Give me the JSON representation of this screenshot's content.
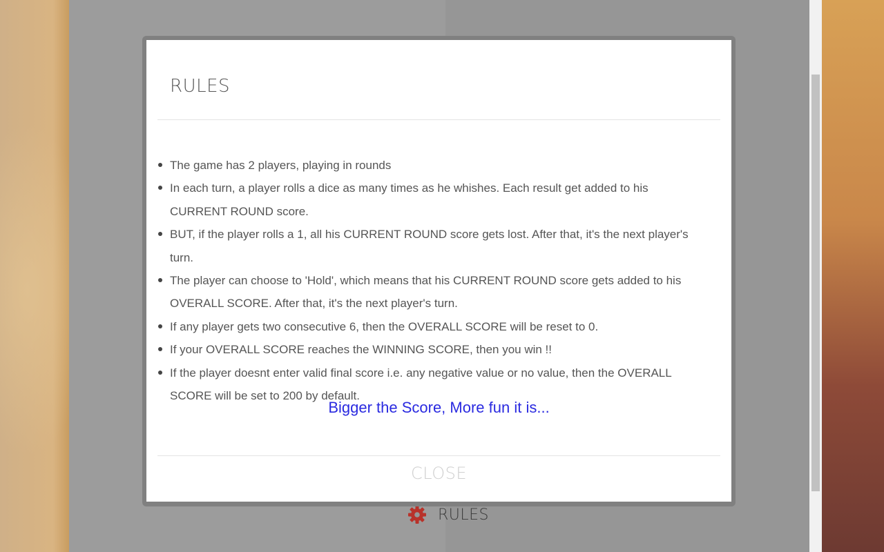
{
  "colors": {
    "accent_link": "#2a2ae0",
    "gear_icon": "#b8322a",
    "text": "#555555",
    "close_text": "#cfcfcf"
  },
  "background": {
    "rules_trigger": {
      "icon": "gear-icon",
      "label": "RULES"
    }
  },
  "modal": {
    "title": "RULES",
    "rules": [
      "The game has 2 players, playing in rounds",
      "In each turn, a player rolls a dice as many times as he whishes. Each result get added to his CURRENT ROUND score.",
      "BUT, if the player rolls a 1, all his CURRENT ROUND score gets lost. After that, it's the next player's turn.",
      "The player can choose to 'Hold', which means that his CURRENT ROUND score gets added to his OVERALL SCORE. After that, it's the next player's turn.",
      "If any player gets two consecutive 6, then the OVERALL SCORE will be reset to 0.",
      "If your OVERALL SCORE reaches the WINNING SCORE, then you win !!",
      "If the player doesnt enter valid final score i.e. any negative value or no value, then the OVERALL SCORE will be set to 200 by default."
    ],
    "tagline": "Bigger the Score, More fun it is...",
    "close_label": "CLOSE"
  }
}
